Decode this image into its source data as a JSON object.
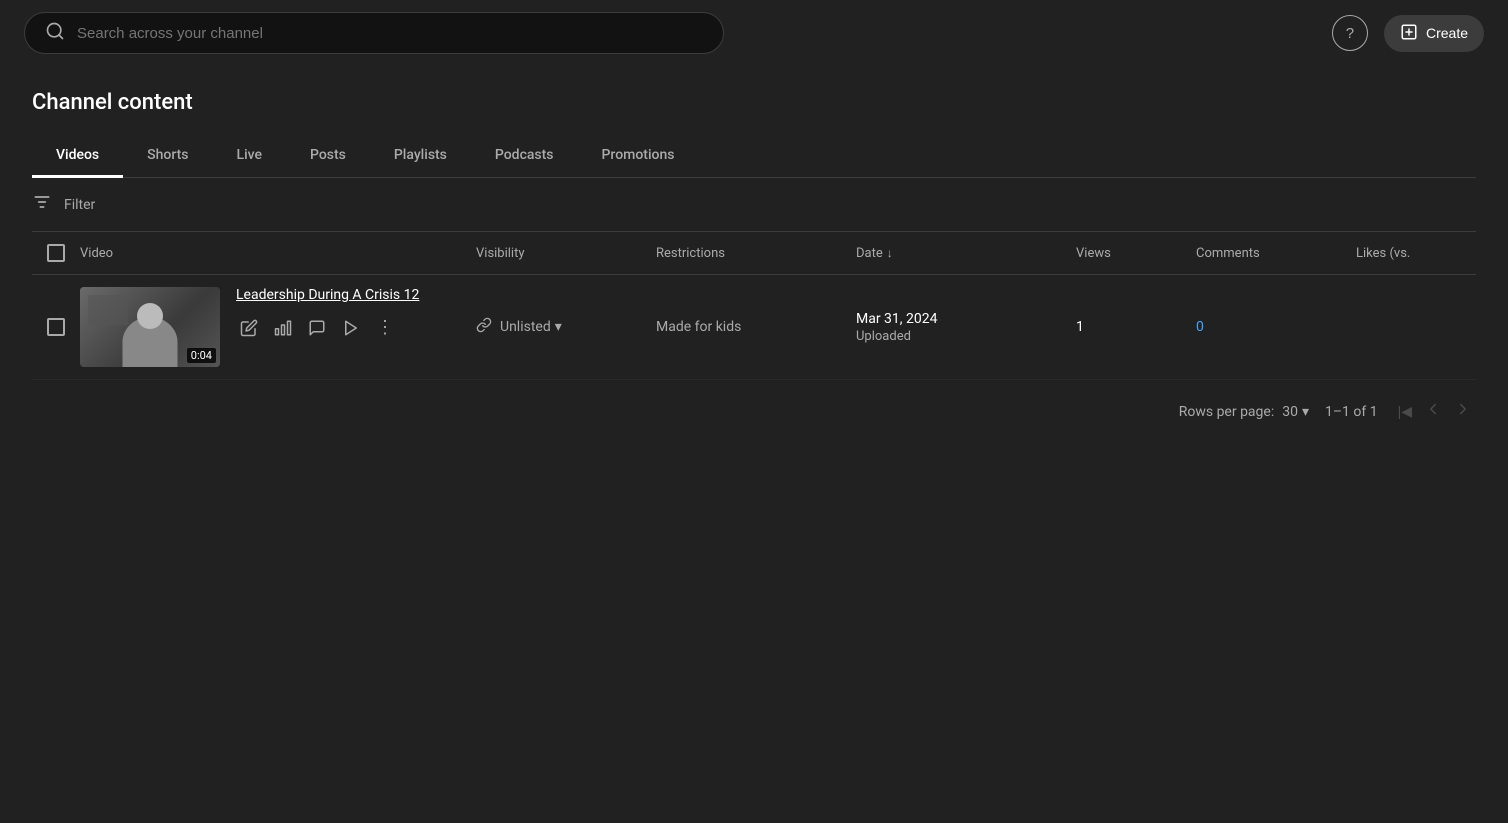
{
  "topbar": {
    "search_placeholder": "Search across your channel",
    "help_label": "?",
    "create_label": "Create",
    "create_icon": "➕"
  },
  "page": {
    "title": "Channel content"
  },
  "tabs": [
    {
      "id": "videos",
      "label": "Videos",
      "active": true
    },
    {
      "id": "shorts",
      "label": "Shorts",
      "active": false
    },
    {
      "id": "live",
      "label": "Live",
      "active": false
    },
    {
      "id": "posts",
      "label": "Posts",
      "active": false
    },
    {
      "id": "playlists",
      "label": "Playlists",
      "active": false
    },
    {
      "id": "podcasts",
      "label": "Podcasts",
      "active": false
    },
    {
      "id": "promotions",
      "label": "Promotions",
      "active": false
    }
  ],
  "filter": {
    "label": "Filter"
  },
  "table": {
    "columns": [
      {
        "id": "video",
        "label": "Video"
      },
      {
        "id": "visibility",
        "label": "Visibility"
      },
      {
        "id": "restrictions",
        "label": "Restrictions"
      },
      {
        "id": "date",
        "label": "Date",
        "sortable": true,
        "sort_icon": "↓"
      },
      {
        "id": "views",
        "label": "Views"
      },
      {
        "id": "comments",
        "label": "Comments"
      },
      {
        "id": "likes",
        "label": "Likes (vs."
      }
    ],
    "rows": [
      {
        "id": "row1",
        "title": "Leadership During A Crisis 12",
        "duration": "0:04",
        "visibility": "Unlisted",
        "visibility_icon": "🔗",
        "restrictions": "Made for kids",
        "date_main": "Mar 31, 2024",
        "date_sub": "Uploaded",
        "views": "1",
        "comments": "0",
        "likes": ""
      }
    ]
  },
  "pagination": {
    "rows_per_page_label": "Rows per page:",
    "rows_per_page_value": "30",
    "page_info": "1–1 of 1"
  }
}
